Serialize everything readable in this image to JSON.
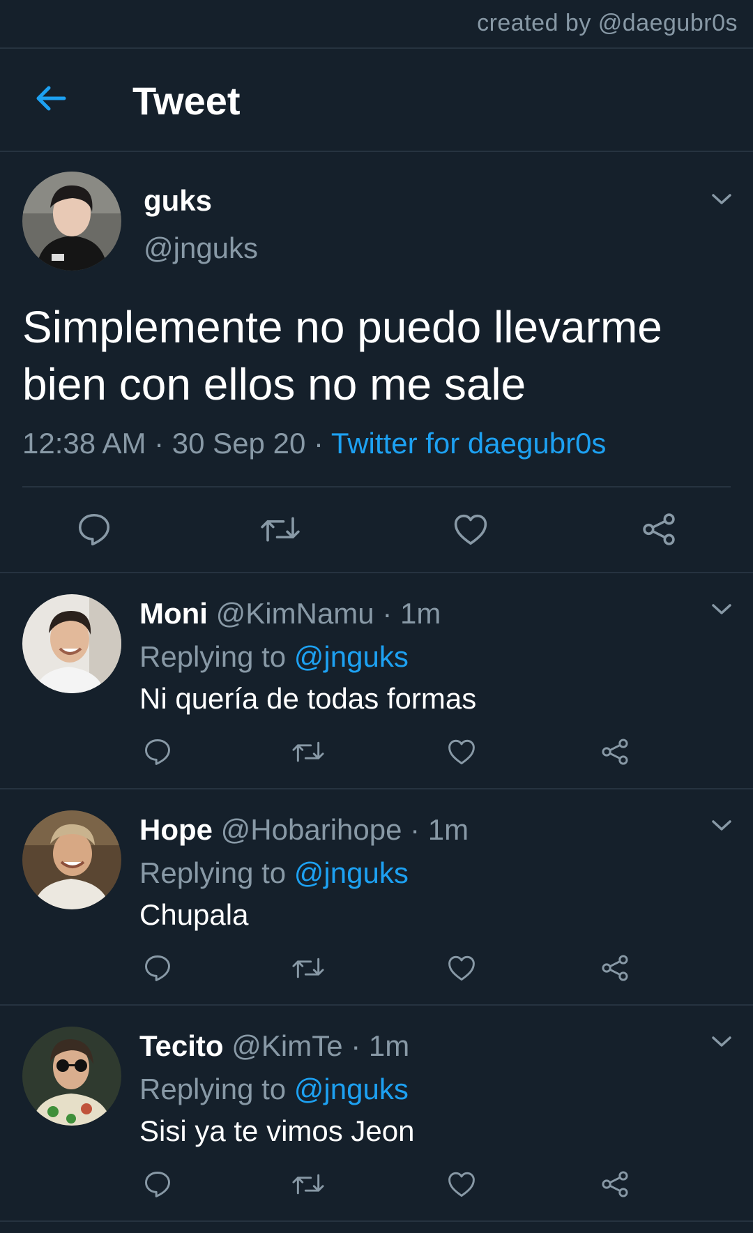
{
  "credit": "created by @daegubr0s",
  "header": {
    "title": "Tweet"
  },
  "tweet": {
    "name": "guks",
    "handle": "@jnguks",
    "text": "Simplemente no puedo llevarme bien con ellos no me sale",
    "time": "12:38 AM",
    "date": "30 Sep 20",
    "source": "Twitter for daegubr0s"
  },
  "replies": [
    {
      "name": "Moni",
      "handle": "@KimNamu",
      "age": "1m",
      "replying_prefix": "Replying to",
      "mention": "@jnguks",
      "text": "Ni quería de todas formas"
    },
    {
      "name": "Hope",
      "handle": "@Hobarihope",
      "age": "1m",
      "replying_prefix": "Replying to",
      "mention": "@jnguks",
      "text": "Chupala"
    },
    {
      "name": "Tecito",
      "handle": "@KimTe",
      "age": "1m",
      "replying_prefix": "Replying to",
      "mention": "@jnguks",
      "text": "Sisi ya te vimos Jeon"
    }
  ],
  "icons": [
    "back-arrow-icon",
    "chevron-down-icon",
    "reply-icon",
    "retweet-icon",
    "like-icon",
    "share-icon"
  ],
  "colors": {
    "background": "#15202b",
    "accent": "#1da1f2",
    "muted": "#8899a6",
    "divider": "#263340"
  }
}
